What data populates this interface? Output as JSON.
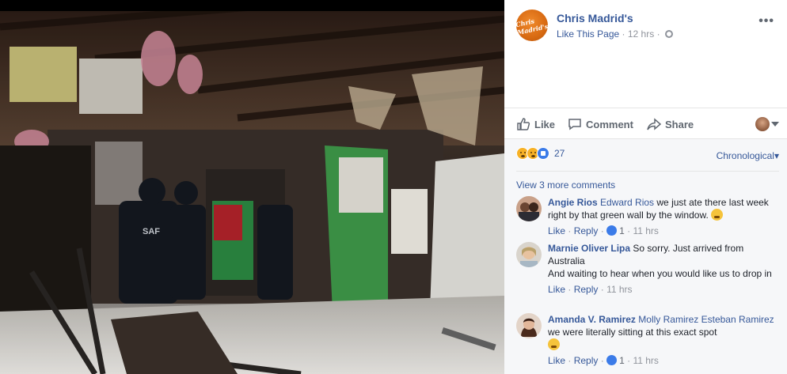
{
  "post": {
    "page_name": "Chris Madrid's",
    "logo_text": "Chris Madrid's",
    "like_page": "Like This Page",
    "time": "12 hrs",
    "more": "•••"
  },
  "actions": {
    "like": "Like",
    "comment": "Comment",
    "share": "Share"
  },
  "reactions": {
    "count": "27",
    "sort": "Chronological"
  },
  "view_more": "View 3 more comments",
  "comments": [
    {
      "author": "Angie Rios",
      "tag": "Edward Rios",
      "text": "we just ate there last week right by that green wall by the window.",
      "like": "Like",
      "reply": "Reply",
      "reaction_count": "1",
      "time": "11 hrs"
    },
    {
      "author": "Marnie Oliver Lipa",
      "text_lines": [
        "So sorry. Just arrived from Australia",
        "And waiting to hear when you would like us to drop in"
      ],
      "like": "Like",
      "reply": "Reply",
      "time": "11 hrs"
    },
    {
      "author": "Amanda V. Ramirez",
      "tag": "Molly Ramirez Esteban Ramirez",
      "text": "we were literally sitting at this exact spot",
      "like": "Like",
      "reply": "Reply",
      "reaction_count": "1",
      "time": "11 hrs"
    }
  ],
  "icons": {
    "like": "thumbs-up-icon",
    "comment": "speech-bubble-icon",
    "share": "share-arrow-icon",
    "privacy": "globe-icon"
  },
  "colors": {
    "link": "#365899",
    "muted": "#90949c",
    "brand_orange": "#d86a12"
  }
}
